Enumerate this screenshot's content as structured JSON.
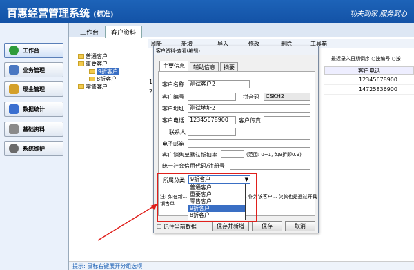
{
  "header": {
    "title": "百惠经营管理系统",
    "edition": "(标准)",
    "slogan": "功夫到家  服务到心"
  },
  "sidebar": [
    {
      "label": "工作台",
      "color": "#2e9b3a"
    },
    {
      "label": "业务管理",
      "color": "#4a78c2"
    },
    {
      "label": "现金管理",
      "color": "#d4a02a"
    },
    {
      "label": "数据统计",
      "color": "#3a6fd0"
    },
    {
      "label": "基础资料",
      "color": "#8a8a8a"
    },
    {
      "label": "系统维护",
      "color": "#6a6a6a"
    }
  ],
  "tabs": {
    "workbench": "工作台",
    "customer": "客户资料"
  },
  "tree": {
    "common": "普通客户",
    "important": "重要客户",
    "nine": "9折客户",
    "eight": "8折客户",
    "zero": "零售客户"
  },
  "toolbar": {
    "refresh": "刷新",
    "new": "新增",
    "import": "导入",
    "edit": "修改",
    "delete": "删除",
    "tools": "工具箱"
  },
  "grid": {
    "sort": "最近录入日期倒序  ○按编号  ○按",
    "phone_header": "客户电话",
    "rows": [
      {
        "n": "1",
        "phone": "12345678900"
      },
      {
        "n": "2",
        "phone": "14725836900"
      }
    ]
  },
  "dialog": {
    "title": "客户资料-查看(编辑)",
    "tabs": [
      "主要信息",
      "辅助信息",
      "摘要"
    ],
    "labels": {
      "name": "客户名称",
      "code": "客户编号",
      "pinyin": "拼音码",
      "address": "客户地址",
      "phone": "客户电话",
      "fax": "客户传真",
      "contact": "联系人",
      "email": "电子邮箱",
      "discount": "客户销售单默认折扣率",
      "discount_hint": "(范围: 0~1, 如9折即0.9)",
      "credit": "统一社会信用代码/注册号",
      "category": "所属分类"
    },
    "values": {
      "name": "测试客户2",
      "pinyin": "CSKH2",
      "address": "测试地址2",
      "phone": "12345678900",
      "category": "9折客户"
    },
    "options": [
      "普通客户",
      "重要客户",
      "零售客户",
      "9折客户",
      "8折客户"
    ],
    "note": "注: 如在新...  在欠款的则通过开具销售单 作为该客户...  欠款也是通过开具销售单",
    "remember": "记住当前数据",
    "buttons": {
      "save_new": "保存并新增",
      "save": "保存",
      "cancel": "取消"
    }
  },
  "status": "提示: 鼠标右键展开分组选项"
}
